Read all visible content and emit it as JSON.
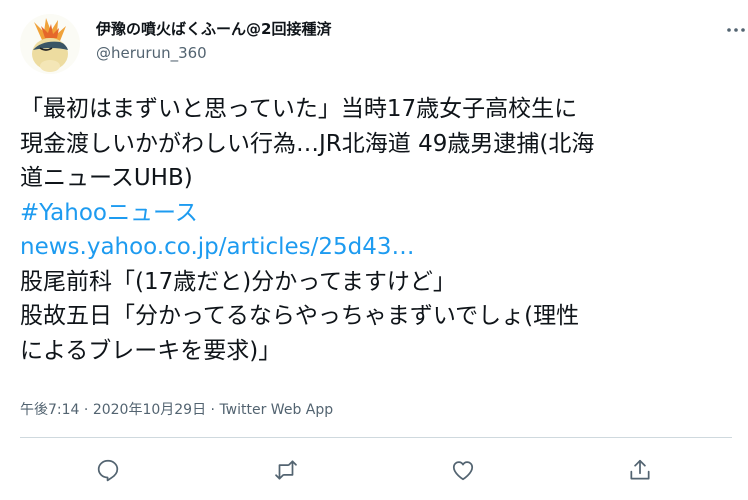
{
  "user": {
    "display_name": "伊豫の噴火ばくふーん@2回接種済",
    "handle": "@herurun_360",
    "avatar_icon": "cyndaquil-avatar-icon"
  },
  "tweet": {
    "lines": [
      "「最初はまずいと思っていた」当時17歳女子高校生に",
      "現金渡しいかがわしい行為…JR北海道 49歳男逮捕(北海",
      "道ニュースUHB)"
    ],
    "hashtag": "#Yahooニュース",
    "link": "news.yahoo.co.jp/articles/25d43…",
    "comment_lines": [
      "股尾前科「(17歳だと)分かってますけど」",
      "股故五日「分かってるならやっちゃまずいでしょ(理性",
      "によるブレーキを要求)」"
    ]
  },
  "meta": {
    "time": "午後7:14",
    "separator1": " · ",
    "date": "2020年10月29日",
    "separator2": " · ",
    "source": "Twitter Web App"
  },
  "actions": {
    "reply_icon": "reply-icon",
    "retweet_icon": "retweet-icon",
    "like_icon": "like-icon",
    "share_icon": "share-icon",
    "icon_color": "#536471",
    "link_color": "#1d9bf0"
  }
}
